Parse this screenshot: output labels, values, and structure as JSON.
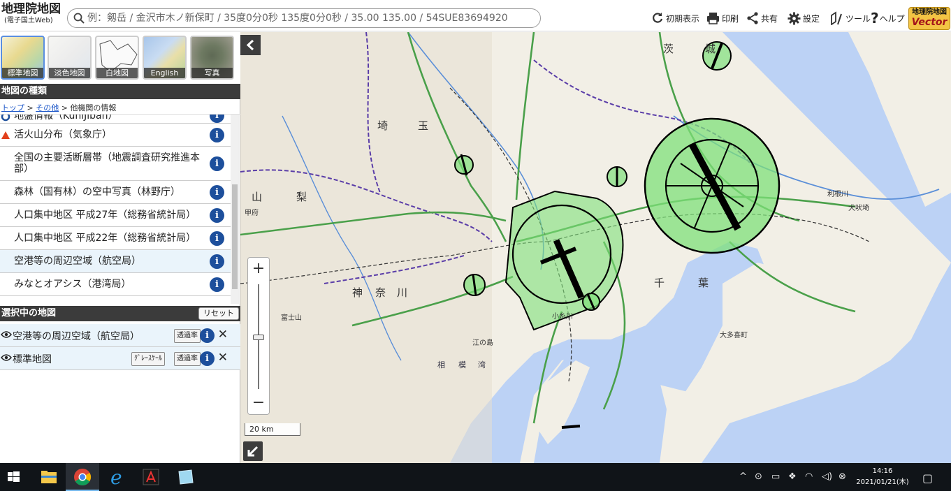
{
  "app": {
    "logo_title": "地理院地図",
    "logo_subtitle": "(電子国土Web)",
    "vector_badge_top": "地理院地図",
    "vector_badge_bottom": "Vector"
  },
  "search": {
    "placeholder": "例：剱岳 / 金沢市木ノ新保町 / 35度0分0秒 135度0分0秒 / 35.00 135.00 / 54SUE83694920"
  },
  "toolbar": {
    "initial_view": "初期表示",
    "print": "印刷",
    "share": "共有",
    "settings": "設定",
    "tools": "ツール",
    "help": "ヘルプ"
  },
  "basemaps": [
    {
      "label": "標準地図",
      "selected": true
    },
    {
      "label": "淡色地図",
      "selected": false
    },
    {
      "label": "白地図",
      "selected": false
    },
    {
      "label": "English",
      "selected": false
    },
    {
      "label": "写真",
      "selected": false
    }
  ],
  "panel": {
    "map_types_heading": "地図の種類",
    "breadcrumb": {
      "top": "トップ",
      "sep1": " > ",
      "other": "その他",
      "sep2": " > ",
      "current": "他機関の情報"
    },
    "map_list": [
      {
        "label": "地盤情報（KuniJiban）",
        "icon": "circle-icon",
        "highlight": false
      },
      {
        "label": "活火山分布（気象庁）",
        "icon": "triangle-icon",
        "highlight": false
      },
      {
        "label": "全国の主要活断層帯（地震調査研究推進本部）",
        "icon": "",
        "highlight": false
      },
      {
        "label": "森林（国有林）の空中写真（林野庁）",
        "icon": "",
        "highlight": false
      },
      {
        "label": "人口集中地区 平成27年（総務省統計局）",
        "icon": "",
        "highlight": false
      },
      {
        "label": "人口集中地区 平成22年（総務省統計局）",
        "icon": "",
        "highlight": false
      },
      {
        "label": "空港等の周辺空域（航空局）",
        "icon": "",
        "highlight": true
      },
      {
        "label": "みなとオアシス（港湾局）",
        "icon": "",
        "highlight": false
      }
    ],
    "selected_heading": "選択中の地図",
    "reset_label": "リセット",
    "selected_layers": [
      {
        "name": "空港等の周辺空域（航空局）",
        "opacity_label": "透過率",
        "grayscale_label": ""
      },
      {
        "name": "標準地図",
        "opacity_label": "透過率",
        "grayscale_label": "ｸﾞﾚｰｽｹｰﾙ"
      }
    ],
    "info_glyph": "i",
    "close_glyph": "✕"
  },
  "map": {
    "scale_label": "20 km",
    "zoom_in": "+",
    "zoom_out": "−",
    "place_labels": [
      {
        "text": "茨"
      },
      {
        "text": "城"
      },
      {
        "text": "埼"
      },
      {
        "text": "玉"
      },
      {
        "text": "山"
      },
      {
        "text": "梨"
      },
      {
        "text": "神"
      },
      {
        "text": "奈"
      },
      {
        "text": "川"
      },
      {
        "text": "千"
      },
      {
        "text": "葉"
      },
      {
        "text": "相"
      },
      {
        "text": "模"
      },
      {
        "text": "湾"
      },
      {
        "text": "利根川"
      },
      {
        "text": "犬吠埼"
      },
      {
        "text": "甲府"
      },
      {
        "text": "富士山"
      },
      {
        "text": "江の島"
      },
      {
        "text": "小糸川"
      },
      {
        "text": "大多喜町"
      }
    ],
    "colors": {
      "airspace_fill": "#7fe07a",
      "sea": "#bcd2f5",
      "land": "#f2efe6"
    }
  },
  "taskbar": {
    "time": "14:16",
    "date": "2021/01/21(木)"
  }
}
